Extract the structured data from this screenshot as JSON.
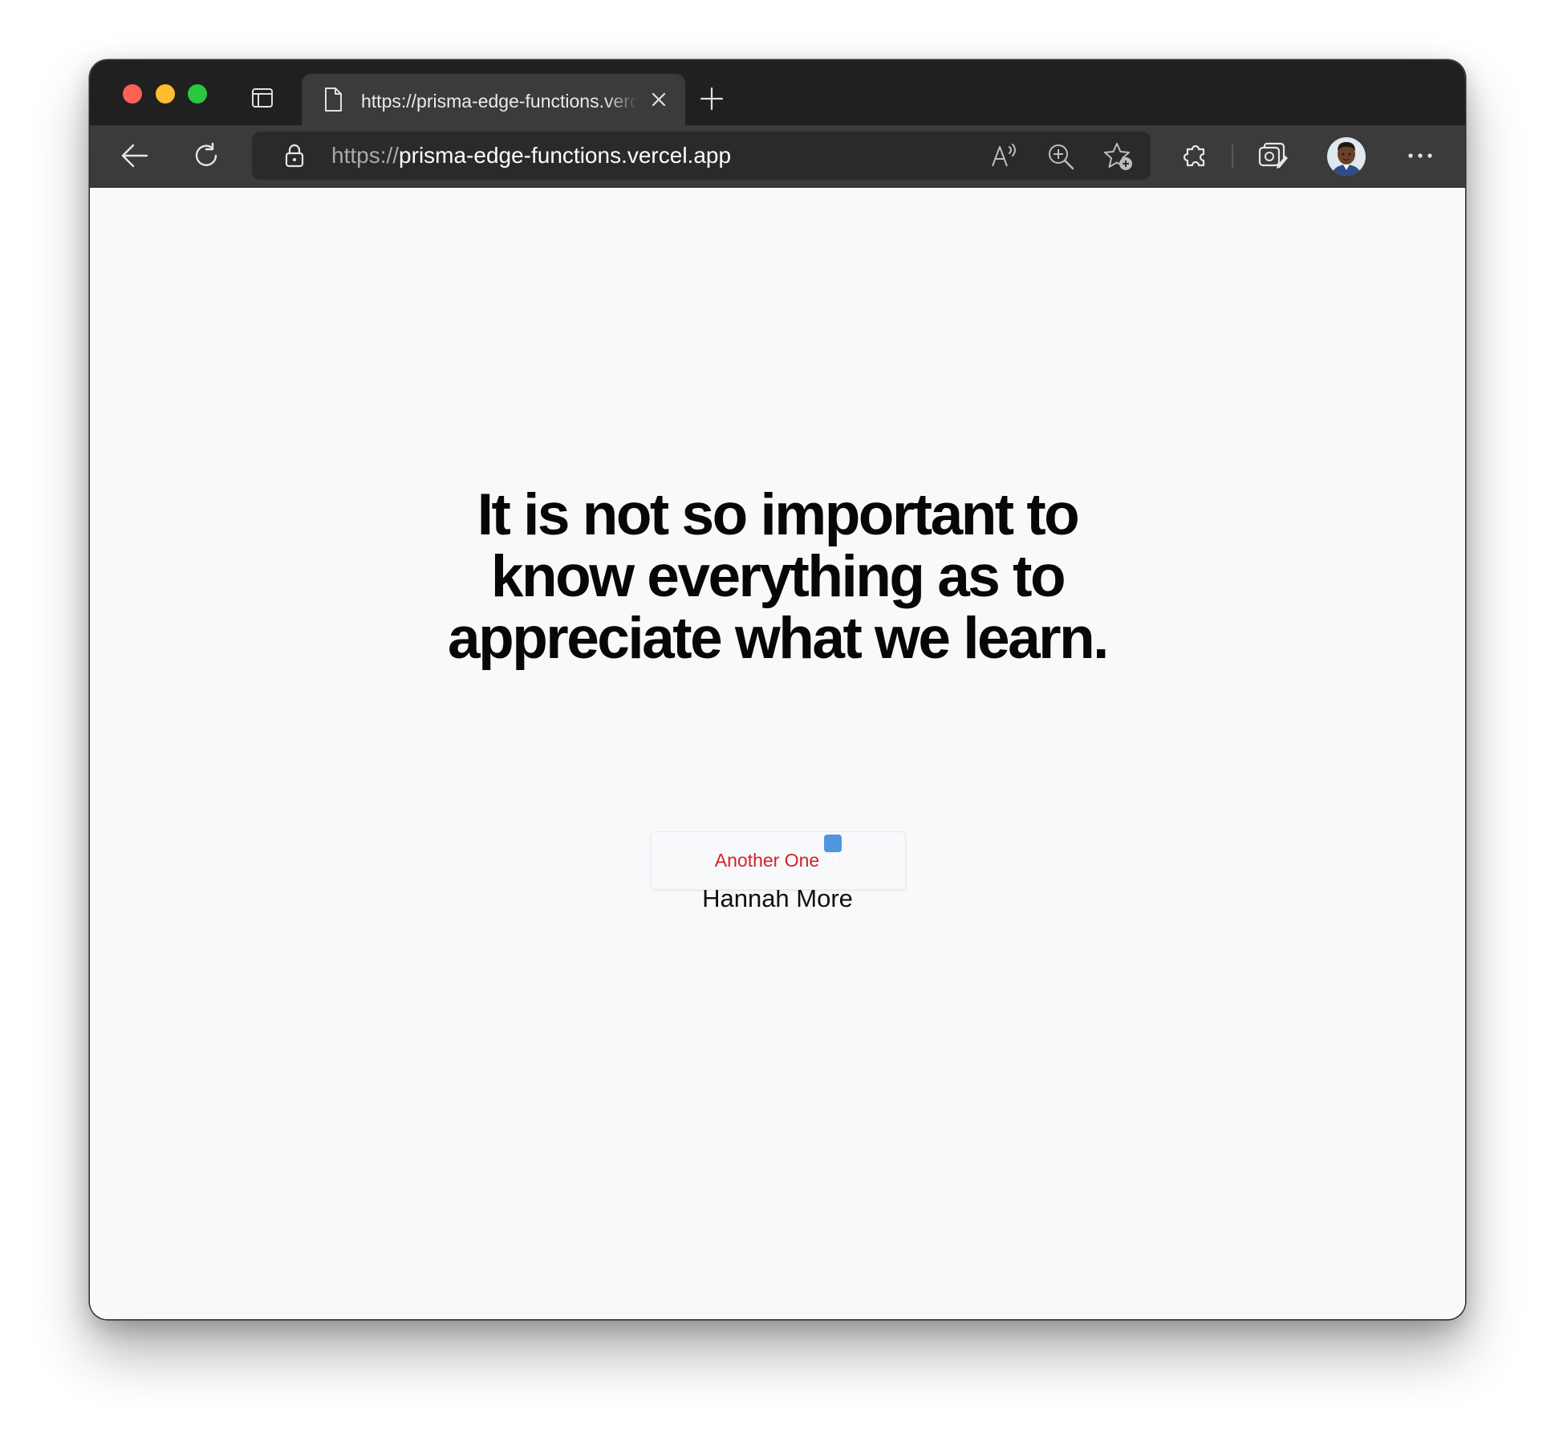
{
  "browser": {
    "tab": {
      "title": "https://prisma-edge-functions.vercel.app"
    },
    "address_bar": {
      "scheme": "https://",
      "host": "prisma-edge-functions.vercel.app"
    },
    "icons": {
      "tab_actions": "tab-actions-icon",
      "page": "page-icon",
      "close_tab": "close-icon",
      "new_tab": "plus-icon",
      "back": "back-arrow-icon",
      "refresh": "refresh-icon",
      "lock": "lock-icon",
      "read_aloud": "read-aloud-icon",
      "zoom": "zoom-in-icon",
      "favorites": "add-favorite-icon",
      "extensions": "extensions-icon",
      "collections": "collections-icon",
      "profile": "avatar",
      "more": "more-icon"
    },
    "colors": {
      "tab_strip": "#202020",
      "toolbar": "#3b3b3b",
      "address_bar": "#2a2a2a",
      "traffic_red": "#fe5f57",
      "traffic_yellow": "#febc2e",
      "traffic_green": "#28c840"
    }
  },
  "page": {
    "quote": "It is not so important to know everything as to appreciate what we learn.",
    "author": "Hannah More",
    "button_label": "Another One",
    "button_emoji": "refresh-emoji-icon",
    "colors": {
      "background": "#f8f9fb",
      "quote_text": "#070707",
      "button_text": "#d1232a"
    }
  }
}
